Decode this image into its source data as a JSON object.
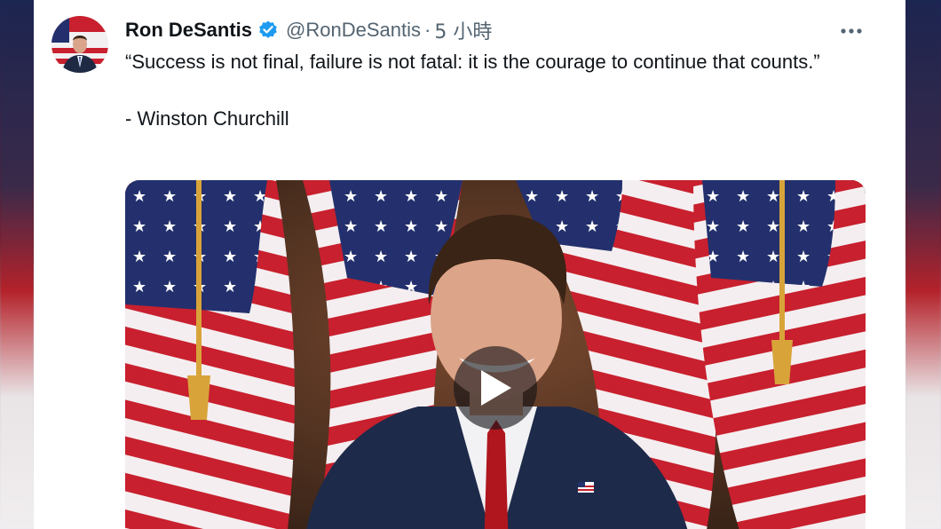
{
  "tweet": {
    "author": {
      "display_name": "Ron DeSantis",
      "handle": "@RonDeSantis",
      "verified": true,
      "verified_icon": "verified-badge-icon"
    },
    "separator": "·",
    "timestamp": "5 小時",
    "more_icon": "more-options-icon",
    "text": {
      "quote": "“Success is not final, failure is not fatal: it is the courage to continue that counts.”",
      "attribution": "- Winston Churchill"
    },
    "media": {
      "type": "video",
      "play_icon": "play-icon"
    }
  },
  "colors": {
    "text_primary": "#0f1419",
    "text_secondary": "#536471",
    "verified_blue": "#1d9bf0",
    "flag_red": "#c8202e",
    "flag_blue": "#23306d"
  }
}
